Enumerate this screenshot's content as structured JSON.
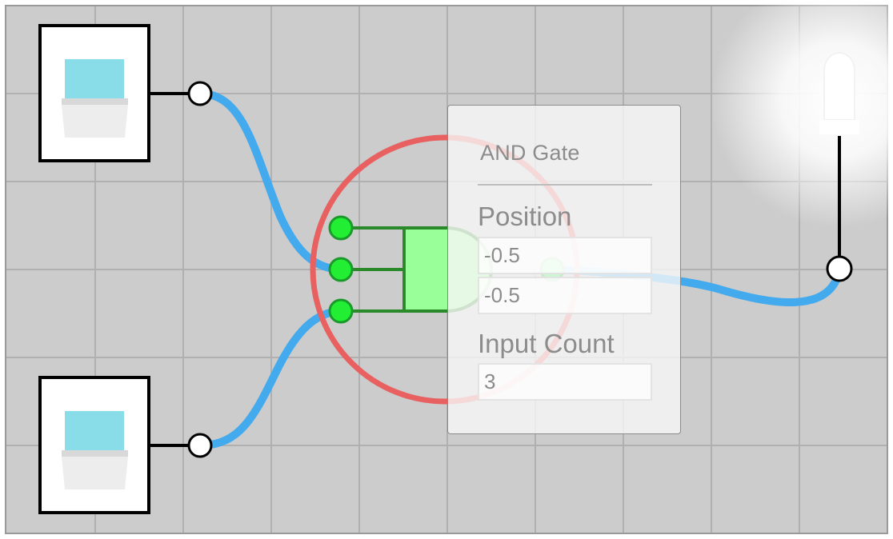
{
  "panel": {
    "title": "AND Gate",
    "position_label": "Position",
    "position_x": "-0.5",
    "position_y": "-0.5",
    "input_count_label": "Input Count",
    "input_count": "3"
  },
  "colors": {
    "grid_background": "#cccccc",
    "grid_lines": "#b0b0b0",
    "wire": "#44aaee",
    "gate_fill": "#99ff99",
    "gate_stroke": "#2a8a2a",
    "input_port": "#22ee33",
    "selection_ring": "#e86060",
    "switch_display": "#88dde8",
    "led_glow": "#ffffff"
  },
  "components": {
    "switches": [
      {
        "name": "switch-top",
        "icon": "switch-icon"
      },
      {
        "name": "switch-bottom",
        "icon": "switch-icon"
      }
    ],
    "gate": {
      "type": "AND",
      "inputs": 3,
      "selected": true
    },
    "output": {
      "name": "led",
      "icon": "led-icon",
      "lit": true
    }
  }
}
